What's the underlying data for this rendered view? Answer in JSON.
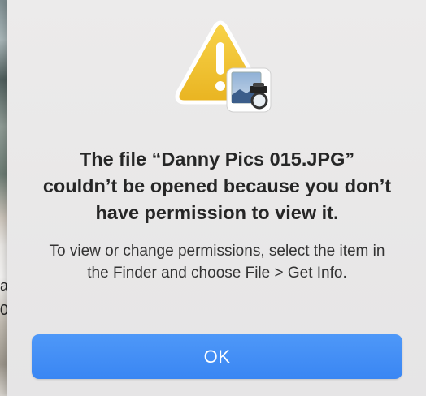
{
  "dialog": {
    "title": "The file “Danny Pics 015.JPG” couldn’t be opened because you don’t have permission to view it.",
    "message": "To view or change permissions, select the item in the Finder and choose File > Get Info.",
    "ok_label": "OK",
    "icon": "warning-icon",
    "badge_icon": "preview-app-icon"
  },
  "background": {
    "fragment_1": "a",
    "fragment_2": "0"
  },
  "colors": {
    "accent": "#3a86f3",
    "warning": "#f2c233"
  }
}
